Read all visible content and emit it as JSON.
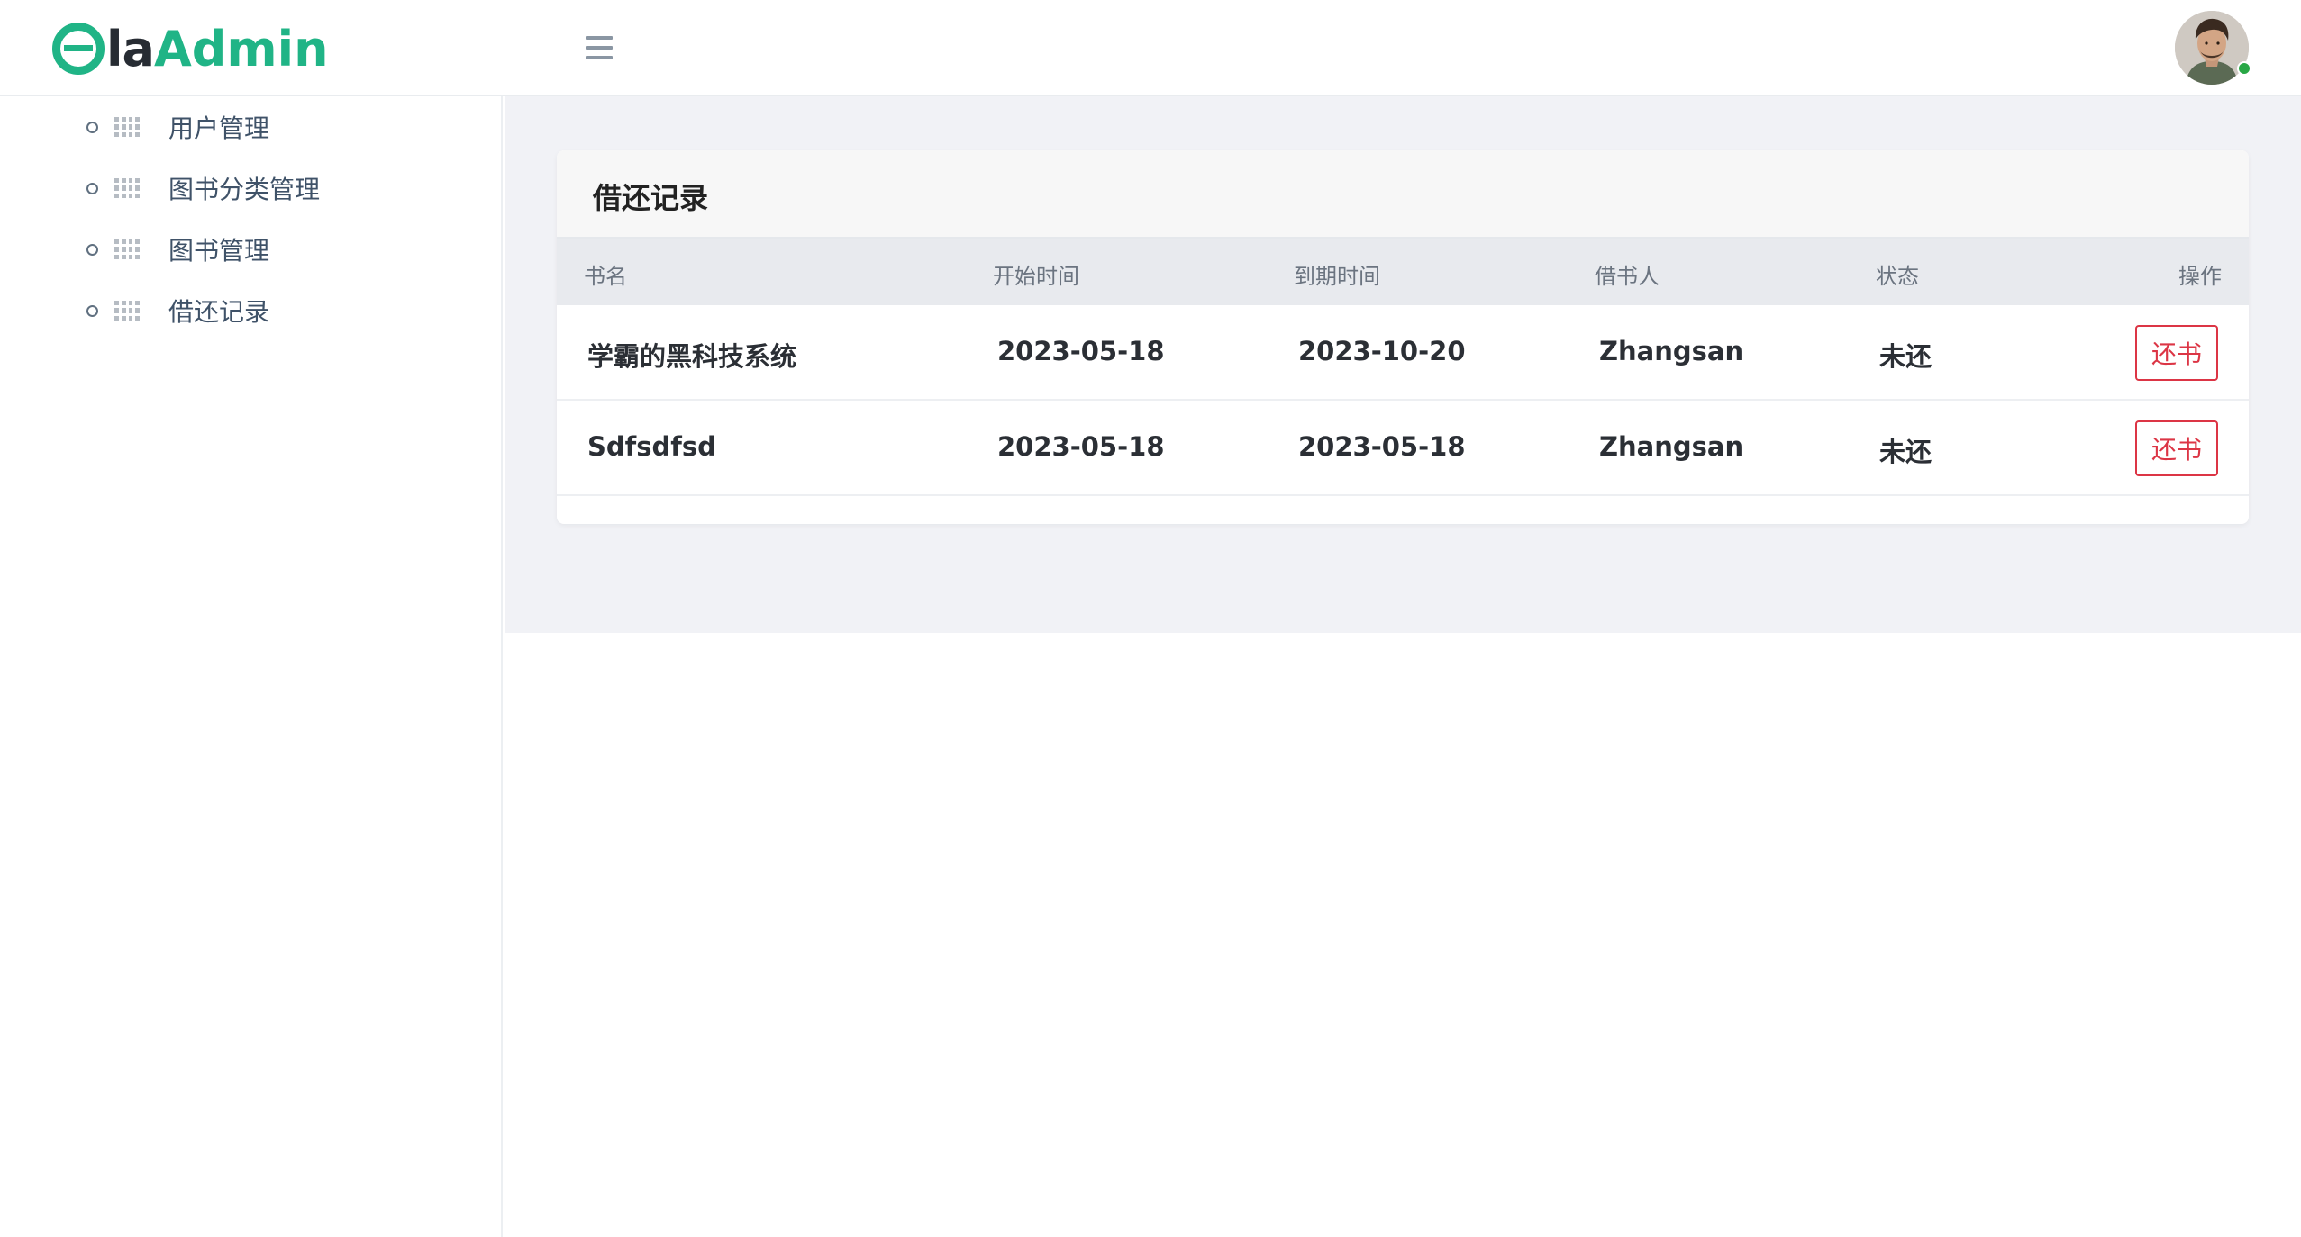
{
  "header": {
    "logo": {
      "part1": "e",
      "part2": "la",
      "part3": "Admin"
    },
    "menu_toggle_icon": "hamburger-icon",
    "avatar_icon": "user-avatar",
    "status_color": "#28a745"
  },
  "sidebar": {
    "items": [
      {
        "label": "用户管理",
        "icon": "grid-icon"
      },
      {
        "label": "图书分类管理",
        "icon": "grid-icon"
      },
      {
        "label": "图书管理",
        "icon": "grid-icon"
      },
      {
        "label": "借还记录",
        "icon": "grid-icon"
      }
    ]
  },
  "main": {
    "card_title": "借还记录",
    "columns": [
      "书名",
      "开始时间",
      "到期时间",
      "借书人",
      "状态",
      "操作"
    ],
    "rows": [
      {
        "book": "学霸的黑科技系统",
        "start": "2023-05-18",
        "due": "2023-10-20",
        "borrower": "Zhangsan",
        "status": "未还",
        "action": "还书"
      },
      {
        "book": "Sdfsdfsd",
        "start": "2023-05-18",
        "due": "2023-05-18",
        "borrower": "Zhangsan",
        "status": "未还",
        "action": "还书"
      }
    ]
  },
  "colors": {
    "brand": "#20b486",
    "danger": "#dc3545",
    "content_bg": "#f1f2f6"
  }
}
